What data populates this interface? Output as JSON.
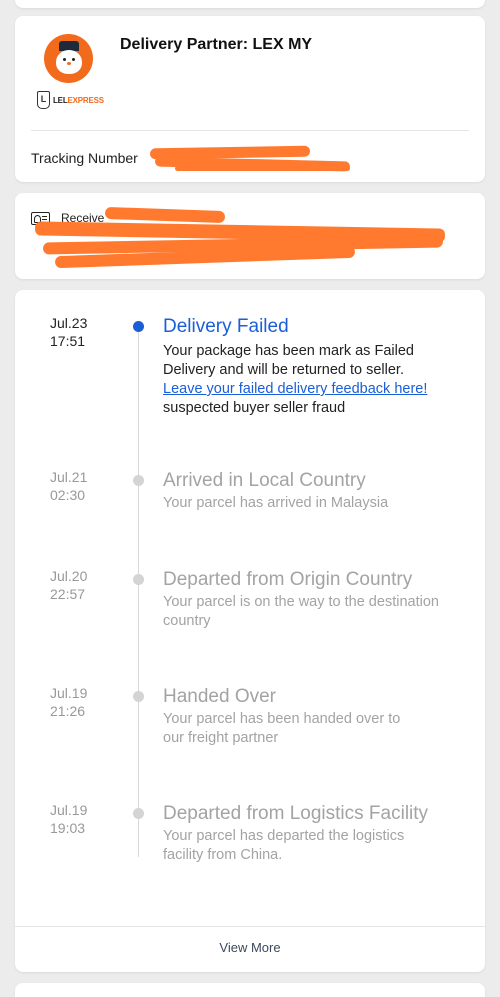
{
  "partner": {
    "title": "Delivery Partner: LEX MY",
    "logo_mark": "L",
    "logo_text_dark": "LEL",
    "logo_text_brand": "EXPRESS",
    "tracking_label": "Tracking Number"
  },
  "receiver": {
    "label": "Receive"
  },
  "colors": {
    "accent": "#1a5ed8",
    "brand": "#f26a1b",
    "inactive": "#a3a3a3"
  },
  "timeline": {
    "events": [
      {
        "date": "Jul.23",
        "time": "17:51",
        "title": "Delivery Failed",
        "desc": "Your package has been mark as Failed Delivery and will be returned to seller.",
        "link": "Leave your failed delivery feedback here!",
        "note": "suspected buyer seller fraud"
      },
      {
        "date": "Jul.21",
        "time": "02:30",
        "title": "Arrived in Local Country",
        "desc": "Your parcel has arrived in Malaysia"
      },
      {
        "date": "Jul.20",
        "time": "22:57",
        "title": "Departed from Origin Country",
        "desc": "Your parcel is on the way to the destination country"
      },
      {
        "date": "Jul.19",
        "time": "21:26",
        "title": "Handed Over",
        "desc": "Your parcel has been handed over to our freight partner"
      },
      {
        "date": "Jul.19",
        "time": "19:03",
        "title": "Departed from Logistics Facility",
        "desc": "Your parcel has departed the logistics facility from China."
      }
    ],
    "view_more": "View More"
  }
}
